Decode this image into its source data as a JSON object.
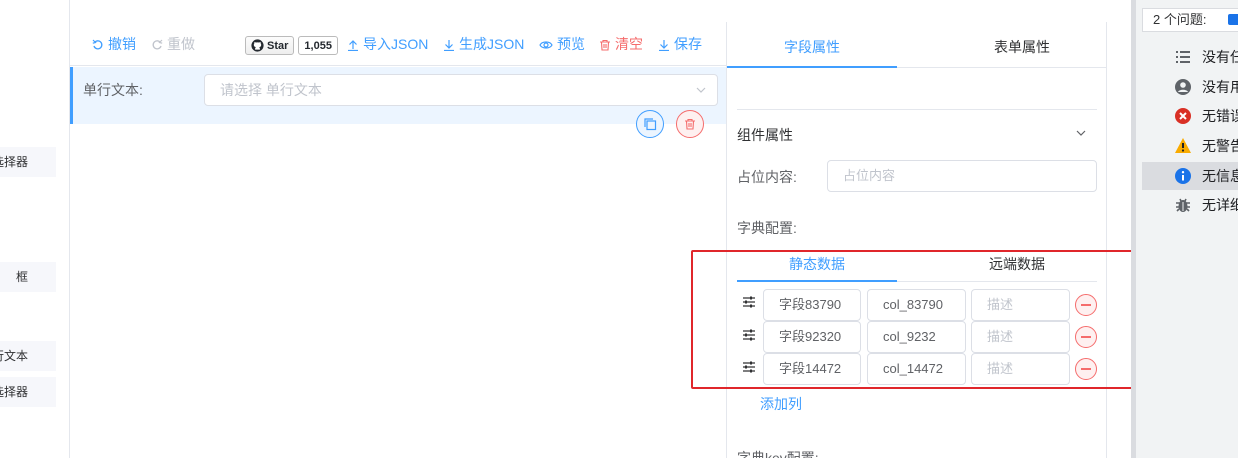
{
  "palette": {
    "items": [
      "间选择器",
      "框",
      "单行文本",
      "间选择器"
    ]
  },
  "toolbar": {
    "undo": "撤销",
    "redo": "重做",
    "github_star": "Star",
    "github_count": "1,055",
    "import_json": "导入JSON",
    "generate_json": "生成JSON",
    "preview": "预览",
    "clear": "清空",
    "save": "保存"
  },
  "canvas": {
    "field_label": "单行文本:",
    "select_placeholder": "请选择 单行文本"
  },
  "panel": {
    "tabs": [
      "字段属性",
      "表单属性"
    ],
    "section_title": "组件属性",
    "placeholder_label": "占位内容:",
    "placeholder_input": "占位内容",
    "dict_label": "字典配置:",
    "sub_tabs": [
      "静态数据",
      "远端数据"
    ],
    "rows": [
      {
        "label": "字段83790",
        "value": "col_83790",
        "desc": "描述"
      },
      {
        "label": "字段92320",
        "value": "col_9232",
        "desc": "描述"
      },
      {
        "label": "字段14472",
        "value": "col_14472",
        "desc": "描述"
      }
    ],
    "add_column": "添加列",
    "dict_key_label": "字典key配置:"
  },
  "devtools": {
    "header": "2 个问题:",
    "items": [
      {
        "icon": "list-icon",
        "label": "没有任何消息"
      },
      {
        "icon": "user-icon",
        "label": "没有用户消息"
      },
      {
        "icon": "error-icon",
        "label": "无错误"
      },
      {
        "icon": "warning-icon",
        "label": "无警告"
      },
      {
        "icon": "info-icon",
        "label": "无信息"
      },
      {
        "icon": "bug-icon",
        "label": "无详细消息"
      }
    ]
  },
  "colors": {
    "primary": "#409eff",
    "danger": "#f56c6c",
    "highlight_border": "#e0262b"
  }
}
